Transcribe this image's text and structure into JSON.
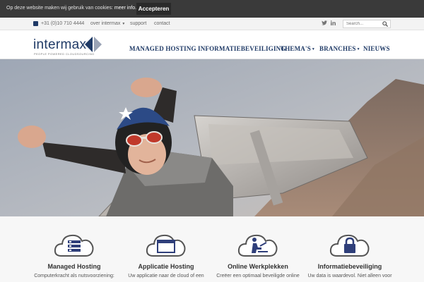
{
  "cookie_bar": {
    "text": "Op deze website maken wij gebruik van cookies:",
    "link": "meer info.",
    "accept": "Accepteren"
  },
  "topbar": {
    "phone": "+31 (0)10 710 4444",
    "about": "over intermax",
    "support": "support",
    "contact": "contact",
    "search_placeholder": "Search..."
  },
  "logo": {
    "word": "intermax",
    "tagline": "PEOPLE POWERED CLOUDSOURCING"
  },
  "nav": {
    "items": [
      {
        "label": "MANAGED HOSTING"
      },
      {
        "label": "INFORMATIEBEVEILIGING"
      },
      {
        "label": "THEMA'S"
      },
      {
        "label": "BRANCHES"
      },
      {
        "label": "NIEUWS"
      }
    ]
  },
  "features": [
    {
      "title": "Managed Hosting",
      "desc": "Computerkracht als nutsvoorziening:",
      "icon": "server-icon"
    },
    {
      "title": "Applicatie Hosting",
      "desc": "Uw applicatie naar de cloud of een",
      "icon": "browser-window-icon"
    },
    {
      "title": "Online Werkplekken",
      "desc": "Creëer een optimaal beveiligde online",
      "icon": "person-at-desk-icon"
    },
    {
      "title": "Informatiebeveiliging",
      "desc": "Uw data is waardevol. Niet alleen voor",
      "icon": "padlock-icon"
    }
  ],
  "colors": {
    "brand_navy": "#1f3a66",
    "cookie_bg": "#3a3a3a",
    "icon_blue": "#2f3f7a",
    "cloud_outline": "#555555"
  }
}
